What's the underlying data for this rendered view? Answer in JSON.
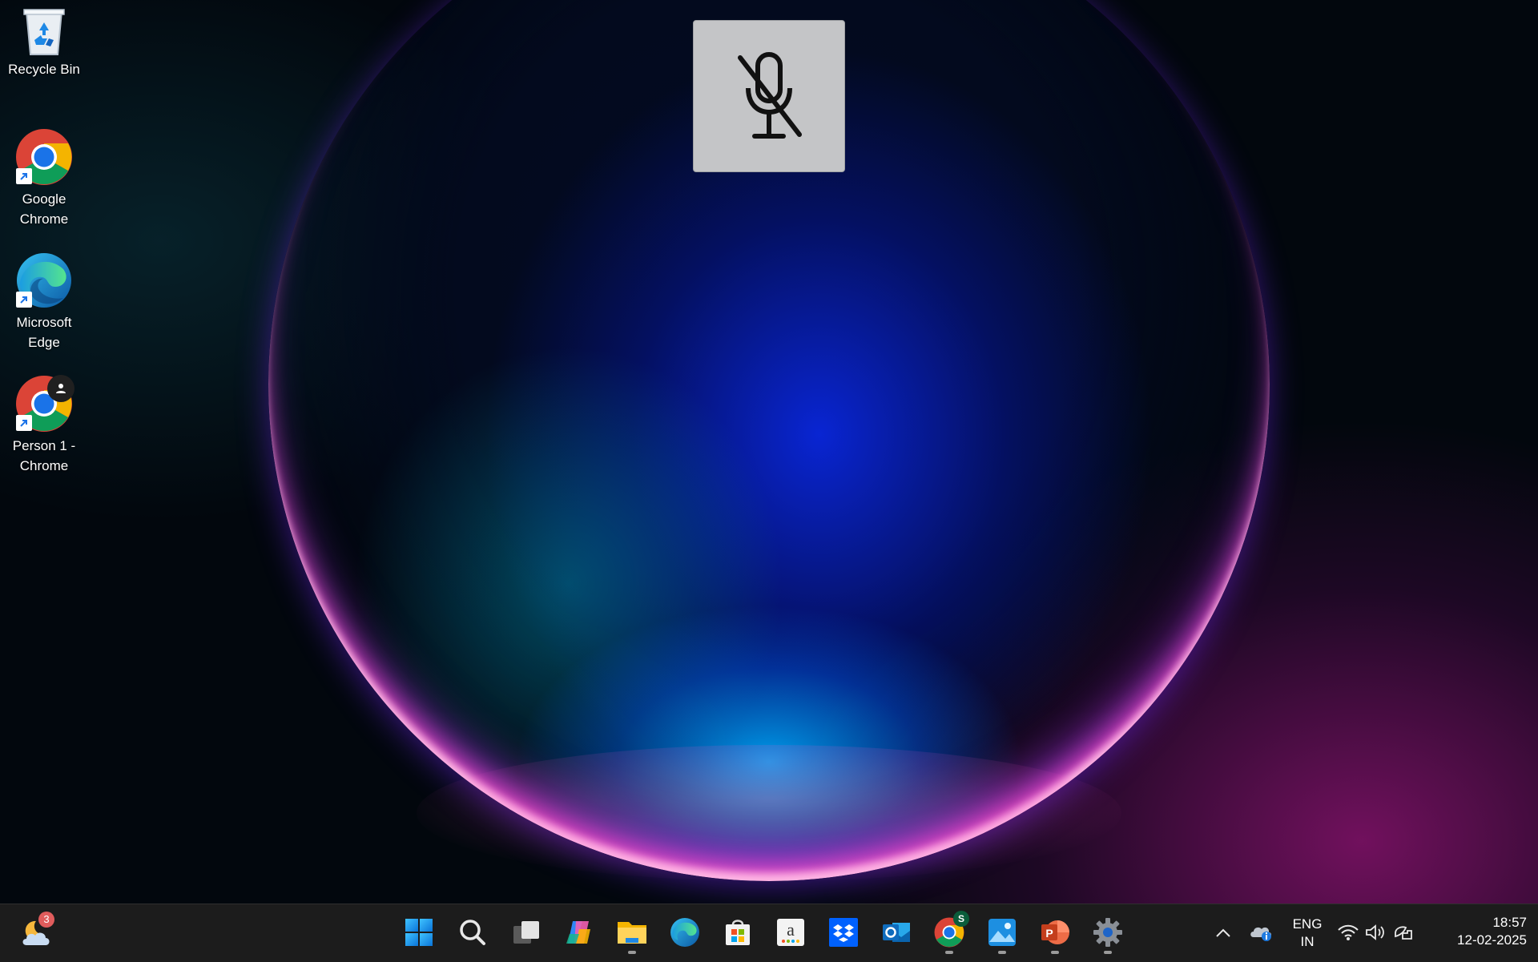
{
  "desktop": {
    "icons": [
      {
        "label": "Recycle Bin"
      },
      {
        "label": "Google\nChrome"
      },
      {
        "label": "Microsoft\nEdge"
      },
      {
        "label": "Person 1 -\nChrome"
      }
    ]
  },
  "osd": {
    "icon": "mic-muted-icon"
  },
  "taskbar": {
    "weather_badge": "3",
    "apps": [
      {
        "name": "start-icon"
      },
      {
        "name": "search-icon"
      },
      {
        "name": "task-view-icon"
      },
      {
        "name": "copilot-icon"
      },
      {
        "name": "file-explorer-icon"
      },
      {
        "name": "edge-icon"
      },
      {
        "name": "store-icon"
      },
      {
        "name": "amazon-icon"
      },
      {
        "name": "dropbox-icon"
      },
      {
        "name": "outlook-icon"
      },
      {
        "name": "chrome-icon"
      },
      {
        "name": "photos-icon"
      },
      {
        "name": "powerpoint-icon"
      },
      {
        "name": "settings-icon"
      }
    ],
    "chrome_badge": "S",
    "lang_line1": "ENG",
    "lang_line2": "IN",
    "time": "18:57",
    "date": "12-02-2025"
  },
  "colors": {
    "taskbar": "#1c1c1c",
    "osd_bg": "#c4c5c7",
    "accent_blue": "#0078d4",
    "badge_red": "#e05c5c"
  }
}
